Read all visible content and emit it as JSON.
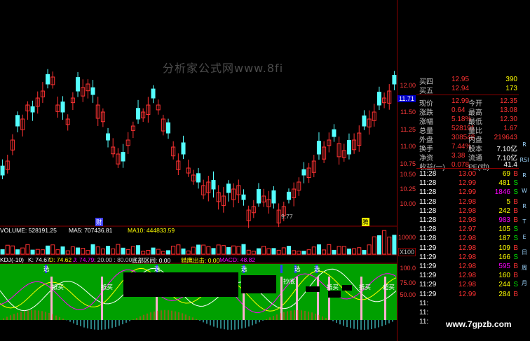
{
  "watermark": "分析家公式网www.8fi",
  "site_watermark": "www.7gpzb.com",
  "price_axis": {
    "ticks": [
      "12.00",
      "11.71",
      "11.50",
      "11.25",
      "11.00",
      "10.75",
      "10.50",
      "10.25",
      "10.00"
    ],
    "current": "11.71"
  },
  "chart_marks": {
    "low_label": "9.77",
    "financial_marker": "财",
    "right_marker": "腾"
  },
  "volume": {
    "label": "VOLUME: 528191.25",
    "ma5": "MA5: 707436.81",
    "ma10": "MA10: 444833.59",
    "axis_top": "10000",
    "axis_mult": "X100"
  },
  "indicator": {
    "name": "KDJ(-10)",
    "k": "K: 74.67",
    "d": "D: 74.62",
    "j": "J: 74.79",
    "levels": ": 20.00 : 80.00",
    "zone": "底部区间: 0.00",
    "signal": "猎鹰出击: 0.00",
    "macd": "MACD: 48.82",
    "axis": [
      "100.0",
      "75.00",
      "50.00"
    ],
    "markers": {
      "xuan": "选",
      "chao": "抄底",
      "dihuan": "抵买",
      "huan": "超买"
    }
  },
  "quote": {
    "ask": [
      {
        "label": "买四",
        "price": "12.95",
        "vol": "390"
      },
      {
        "label": "买五",
        "price": "12.94",
        "vol": "173"
      }
    ],
    "stats": [
      {
        "l1": "现价",
        "v1": "12.99",
        "l2": "今开",
        "v2": "12.35"
      },
      {
        "l1": "涨跌",
        "v1": "0.64",
        "l2": "最高",
        "v2": "13.08"
      },
      {
        "l1": "涨幅",
        "v1": "5.18%",
        "l2": "最低",
        "v2": "12.30"
      },
      {
        "l1": "总量",
        "v1": "528191",
        "l2": "量比",
        "v2": "1.67"
      },
      {
        "l1": "外盘",
        "v1": "308548",
        "l2": "内盘",
        "v2": "219643"
      },
      {
        "l1": "换手",
        "v1": "7.44%",
        "l2": "股本",
        "v2": "7.10亿"
      },
      {
        "l1": "净资",
        "v1": "3.38",
        "l2": "流通",
        "v2": "7.10亿"
      },
      {
        "l1": "收益(一)",
        "v1": "0.078",
        "l2": "PE(动)",
        "v2": "41.4"
      }
    ],
    "ticks": [
      {
        "t": "11:28",
        "p": "13.00",
        "v": "69",
        "s": "B"
      },
      {
        "t": "11:28",
        "p": "12.99",
        "v": "481",
        "s": "S"
      },
      {
        "t": "11:28",
        "p": "12.99",
        "v": "1846",
        "s": "S"
      },
      {
        "t": "11:28",
        "p": "12.98",
        "v": "5",
        "s": "B"
      },
      {
        "t": "11:28",
        "p": "12.98",
        "v": "242",
        "s": "B"
      },
      {
        "t": "11:28",
        "p": "12.98",
        "v": "983",
        "s": "B"
      },
      {
        "t": "11:28",
        "p": "12.97",
        "v": "105",
        "s": "S"
      },
      {
        "t": "11:28",
        "p": "12.98",
        "v": "187",
        "s": "S"
      },
      {
        "t": "11:29",
        "p": "12.98",
        "v": "109",
        "s": "B"
      },
      {
        "t": "11:29",
        "p": "12.98",
        "v": "166",
        "s": "S"
      },
      {
        "t": "11:29",
        "p": "12.98",
        "v": "595",
        "s": "B"
      },
      {
        "t": "11:29",
        "p": "12.98",
        "v": "160",
        "s": "B"
      },
      {
        "t": "11:29",
        "p": "12.98",
        "v": "244",
        "s": "S"
      },
      {
        "t": "11:29",
        "p": "12.99",
        "v": "284",
        "s": "B"
      },
      {
        "t": "11:",
        "p": "",
        "v": "",
        "s": ""
      },
      {
        "t": "11:",
        "p": "",
        "v": "",
        "s": ""
      },
      {
        "t": "11:",
        "p": "",
        "v": "",
        "s": ""
      }
    ]
  },
  "toolbar": [
    "R",
    "RSI",
    "R",
    "W",
    "R",
    "T",
    "E",
    "日",
    "周",
    "月"
  ],
  "colors": {
    "up": "#ff3232",
    "down": "#00ffff",
    "grid": "#8b0000",
    "panel_green": "#00a000"
  }
}
